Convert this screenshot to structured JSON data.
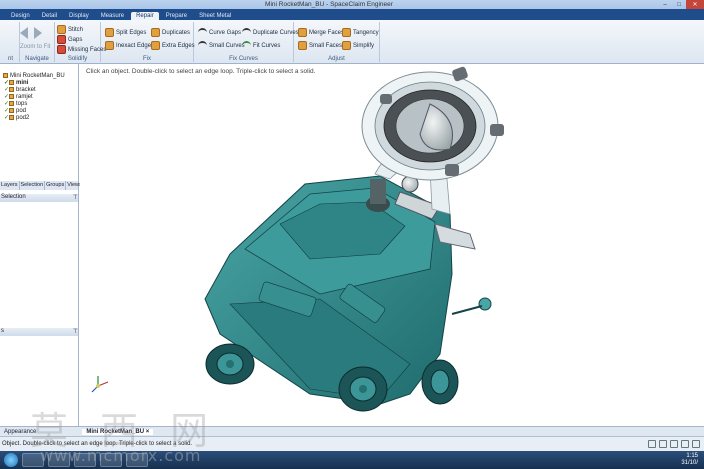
{
  "window": {
    "title": "Mini RocketMan_BU - SpaceClaim Engineer",
    "min": "–",
    "max": "□",
    "close": "✕"
  },
  "ribbon_tabs": [
    "Design",
    "Detail",
    "Display",
    "Measure",
    "Repair",
    "Prepare",
    "Sheet Metal"
  ],
  "active_tab": "Repair",
  "ribbon": {
    "solidify": {
      "title": "Solidify",
      "stitch": "Stitch",
      "gaps": "Gaps",
      "missing_faces": "Missing Faces"
    },
    "navigate": {
      "title": "Navigate",
      "zoom_to_fit": "Zoom to Fit"
    },
    "fix": {
      "title": "Fix",
      "split_edges": "Split Edges",
      "inexact_edges": "Inexact Edges",
      "duplicates": "Duplicates",
      "extra_edges": "Extra Edges"
    },
    "fix_curves": {
      "title": "Fix Curves",
      "curve_gaps": "Curve Gaps",
      "small_curves": "Small Curves",
      "duplicate_curves": "Duplicate Curves",
      "fit_curves": "Fit Curves"
    },
    "adjust": {
      "title": "Adjust",
      "merge_faces": "Merge Faces",
      "small_faces": "Small Faces",
      "tangency": "Tangency",
      "simplify": "Simplify"
    }
  },
  "tree": {
    "root": "Mini RocketMan_BU",
    "children": [
      "mini",
      "bracket",
      "ramjet",
      "tops",
      "pod",
      "pod2"
    ]
  },
  "panel_tabs": [
    "Layers",
    "Selection",
    "Groups",
    "Views"
  ],
  "selection_panel": {
    "title": "Selection"
  },
  "viewport": {
    "hint": "Click an object. Double-click to select an edge loop. Triple-click to select a solid."
  },
  "doc_tabs": {
    "appearance": "Appearance",
    "document": "Mini RocketMan_BU",
    "close": "×"
  },
  "status": {
    "text": "Object. Double-click to select an edge loop. Triple-click to select a solid."
  },
  "taskbar": {
    "time": "1:15",
    "date": "31/10/"
  },
  "watermark": {
    "cn": "莫 西 网",
    "url": "www.mcmorx.com"
  },
  "colors": {
    "model_teal": "#2e8a8c",
    "model_dark": "#1d5f62",
    "ribbon_blue": "#1f4d8c"
  }
}
